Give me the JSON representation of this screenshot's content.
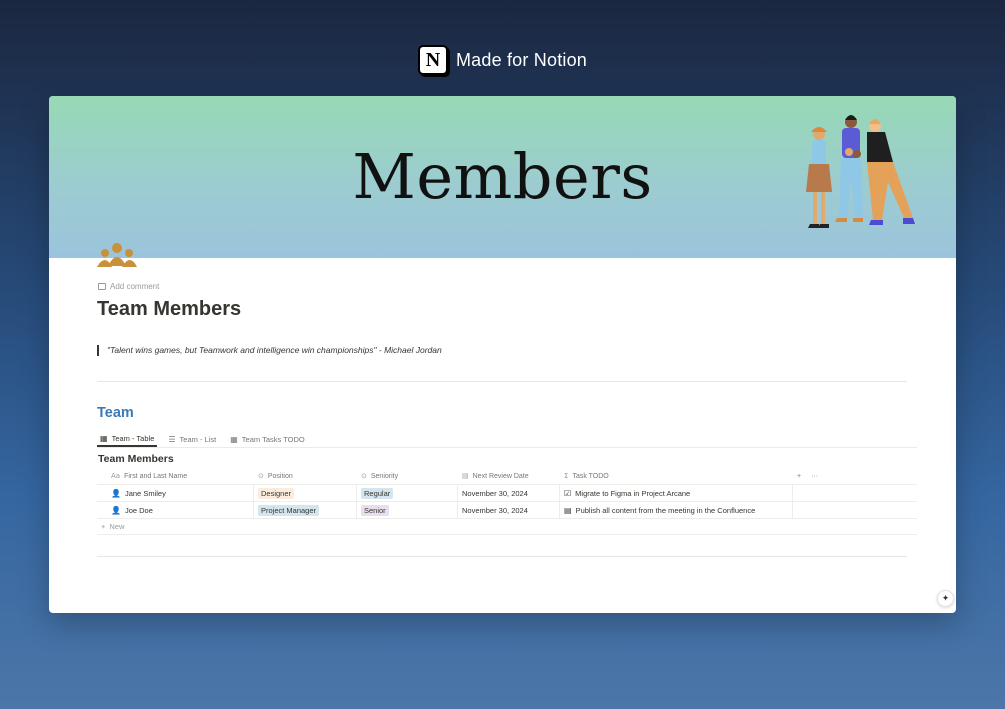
{
  "brand": {
    "logo_letter": "N",
    "text": "Made for Notion"
  },
  "cover": {
    "title": "Members"
  },
  "page": {
    "add_comment": "Add comment",
    "title": "Team Members",
    "quote": "\"Talent wins games, but Teamwork and intelligence win championships\" - Michael Jordan"
  },
  "section": {
    "title": "Team"
  },
  "tabs": [
    {
      "label": "Team - Table",
      "icon": "table-icon",
      "active": true
    },
    {
      "label": "Team - List",
      "icon": "list-icon",
      "active": false
    },
    {
      "label": "Team Tasks TODO",
      "icon": "table-icon",
      "active": false
    }
  ],
  "database": {
    "title": "Team Members",
    "columns": [
      {
        "label": "First and Last Name",
        "icon": "Aa"
      },
      {
        "label": "Position",
        "icon": "select-icon"
      },
      {
        "label": "Seniority",
        "icon": "select-icon"
      },
      {
        "label": "Next Review Date",
        "icon": "calendar-icon"
      },
      {
        "label": "Task TODO",
        "icon": "sigma-icon"
      }
    ],
    "rows": [
      {
        "name": "Jane Smiley",
        "position": "Designer",
        "position_color": "#fbecdd",
        "seniority": "Regular",
        "seniority_color": "#d3e5ef",
        "review_date": "November 30, 2024",
        "task": "Migrate to Figma in Project Arcane",
        "person_color": "#37352f"
      },
      {
        "name": "Joe Doe",
        "position": "Project Manager",
        "position_color": "#d3e5ef",
        "seniority": "Senior",
        "seniority_color": "#e8deee",
        "review_date": "November 30, 2024",
        "task": "Publish all content from the meeting in the Confluence",
        "person_color": "#9065b0"
      }
    ],
    "new_label": "New"
  },
  "colors": {
    "accent": "#3b7ab7",
    "cover_top": "#97d9b5",
    "cover_bottom": "#9bc4dd",
    "icon_gold": "#c8913a"
  }
}
